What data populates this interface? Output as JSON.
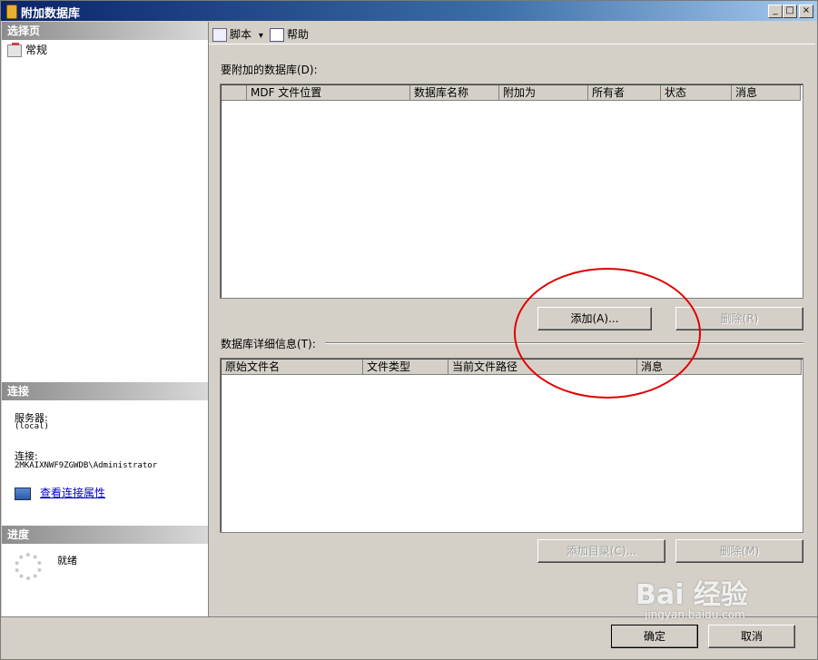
{
  "window": {
    "title": "附加数据库",
    "minimize": "_",
    "maximize": "□",
    "close": "×"
  },
  "left": {
    "select_page_header": "选择页",
    "nav_items": [
      {
        "label": "常规",
        "icon": "page-icon"
      }
    ],
    "connection_header": "连接",
    "server_label": "服务器:",
    "server_value": "(local)",
    "connection_label": "连接:",
    "connection_value": "2MKAIXNWF9ZGWDB\\Administrator",
    "view_props_link": "查看连接属性",
    "progress_header": "进度",
    "progress_status": "就绪"
  },
  "toolbar": {
    "script_label": "脚本",
    "script_dropdown": "▾",
    "help_label": "帮助"
  },
  "attach": {
    "label": "要附加的数据库(D):",
    "columns": [
      "",
      "MDF 文件位置",
      "数据库名称",
      "附加为",
      "所有者",
      "状态",
      "消息"
    ],
    "rows": [],
    "add_button": "添加(A)...",
    "remove_button": "删除(R)"
  },
  "details": {
    "label": "数据库详细信息(T):",
    "columns": [
      "原始文件名",
      "文件类型",
      "当前文件路径",
      "消息"
    ],
    "rows": [],
    "add_catalog_button": "添加目录(C)...",
    "remove_button": "删除(M)"
  },
  "footer": {
    "ok_button": "确定",
    "cancel_button": "取消"
  },
  "watermark": {
    "text": "Bai 经验",
    "url": "jingyan.baidu.com"
  },
  "colors": {
    "title_gradient_start": "#0a246a",
    "annotation_circle": "#e00000",
    "link": "#0000cc"
  }
}
